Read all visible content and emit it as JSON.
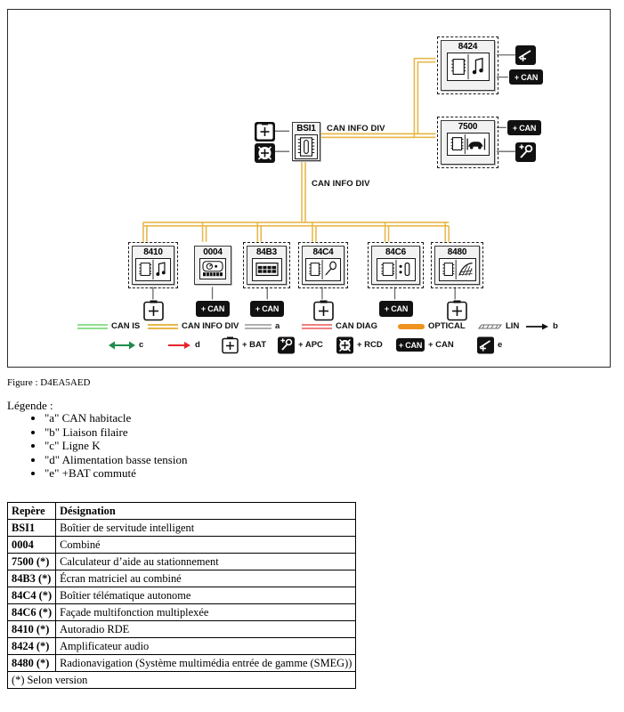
{
  "figure": {
    "caption": "Figure : D4EA5AED",
    "frame_border_color": "#2b2b2b"
  },
  "colors": {
    "can_is": "#8fe08f",
    "can_info_div": "#e8b84b",
    "wire_a": "#b0b0b0",
    "can_diag": "#f08080",
    "optical": "#f0921e",
    "lin": "#9a9a9a",
    "arrow_b": "#111111",
    "arrow_c": "#1f8b4c",
    "arrow_d": "#e8232a",
    "badge_bg": "#111111",
    "module_fill": "#f2f2f2"
  },
  "diagram": {
    "bus_labels": [
      {
        "text": "CAN INFO DIV"
      },
      {
        "text": "CAN INFO DIV"
      }
    ],
    "modules": [
      {
        "id": "8424",
        "label": "8424",
        "icon": "amplifier-icon",
        "border": "dashed"
      },
      {
        "id": "7500",
        "label": "7500",
        "icon": "parking-aid-icon",
        "border": "dashed"
      },
      {
        "id": "BSI1",
        "label": "BSI1",
        "icon": "bsi-module-icon",
        "border": "solid"
      },
      {
        "id": "8410",
        "label": "8410",
        "icon": "radio-icon",
        "border": "dashed"
      },
      {
        "id": "0004",
        "label": "0004",
        "icon": "instrument-cluster-icon",
        "border": "solid"
      },
      {
        "id": "84B3",
        "label": "84B3",
        "icon": "matrix-screen-icon",
        "border": "dashed"
      },
      {
        "id": "84C4",
        "label": "84C4",
        "icon": "telematics-icon",
        "border": "dashed"
      },
      {
        "id": "84C6",
        "label": "84C6",
        "icon": "multifunction-panel-icon",
        "border": "dashed"
      },
      {
        "id": "8480",
        "label": "8480",
        "icon": "navigation-icon",
        "border": "dashed"
      }
    ],
    "badges": [
      {
        "for": "8424",
        "type": "symbol",
        "icon": "switched-bat-icon"
      },
      {
        "for": "8424",
        "type": "can",
        "label": "+ CAN"
      },
      {
        "for": "7500",
        "type": "can",
        "label": "+ CAN"
      },
      {
        "for": "7500",
        "type": "symbol",
        "icon": "apc-key-icon"
      },
      {
        "for": "BSI1",
        "type": "symbol",
        "icon": "bat-icon"
      },
      {
        "for": "BSI1",
        "type": "symbol",
        "icon": "rcd-icon"
      },
      {
        "for": "8410",
        "type": "symbol",
        "icon": "bat-icon"
      },
      {
        "for": "0004",
        "type": "can",
        "label": "+ CAN"
      },
      {
        "for": "84B3",
        "type": "can",
        "label": "+ CAN"
      },
      {
        "for": "84C4",
        "type": "symbol",
        "icon": "bat-icon"
      },
      {
        "for": "84C6",
        "type": "can",
        "label": "+ CAN"
      },
      {
        "for": "8480",
        "type": "symbol",
        "icon": "bat-icon"
      }
    ]
  },
  "legend": {
    "row1": [
      {
        "key": "can-is",
        "label": "CAN IS",
        "symbol": "double-line",
        "color": "#8fe08f"
      },
      {
        "key": "can-info-div",
        "label": "CAN INFO DIV",
        "symbol": "double-line",
        "color": "#e8b84b"
      },
      {
        "key": "a",
        "label": "a",
        "symbol": "double-line",
        "color": "#b0b0b0"
      },
      {
        "key": "can-diag",
        "label": "CAN DIAG",
        "symbol": "double-line",
        "color": "#f08080"
      },
      {
        "key": "optical",
        "label": "OPTICAL",
        "symbol": "thick-bar",
        "color": "#f0921e"
      },
      {
        "key": "lin",
        "label": "LIN",
        "symbol": "hatched-bar",
        "color": "#9a9a9a"
      },
      {
        "key": "b",
        "label": "b",
        "symbol": "arrow-right",
        "color": "#111111"
      }
    ],
    "row2": [
      {
        "key": "c",
        "label": "c",
        "symbol": "arrow-double",
        "color": "#1f8b4c"
      },
      {
        "key": "d",
        "label": "d",
        "symbol": "arrow-right",
        "color": "#e8232a"
      },
      {
        "key": "bat",
        "label": "+ BAT",
        "symbol": "bat-icon"
      },
      {
        "key": "apc",
        "label": "+ APC",
        "symbol": "apc-key-icon"
      },
      {
        "key": "rcd",
        "label": "+ RCD",
        "symbol": "rcd-icon"
      },
      {
        "key": "can",
        "label": "+ CAN",
        "symbol": "can-badge"
      },
      {
        "key": "e",
        "label": "e",
        "symbol": "switched-bat-icon"
      }
    ]
  },
  "legende": {
    "title": "Légende :",
    "items": [
      "\"a\" CAN habitacle",
      "\"b\" Liaison filaire",
      "\"c\" Ligne K",
      "\"d\" Alimentation basse tension",
      "\"e\" +BAT commuté"
    ]
  },
  "table": {
    "headers": [
      "Repère",
      "Désignation"
    ],
    "rows": [
      [
        "BSI1",
        "Boîtier de servitude intelligent"
      ],
      [
        "0004",
        "Combiné"
      ],
      [
        "7500 (*)",
        "Calculateur d’aide au stationnement"
      ],
      [
        "84B3 (*)",
        "Écran matriciel au combiné"
      ],
      [
        "84C4 (*)",
        "Boîtier télématique autonome"
      ],
      [
        "84C6 (*)",
        "Façade multifonction multiplexée"
      ],
      [
        "8410 (*)",
        "Autoradio RDE"
      ],
      [
        "8424 (*)",
        "Amplificateur audio"
      ],
      [
        "8480 (*)",
        "Radionavigation (Système multimédia entrée de gamme (SMEG))"
      ]
    ],
    "footnote": "(*) Selon version"
  }
}
